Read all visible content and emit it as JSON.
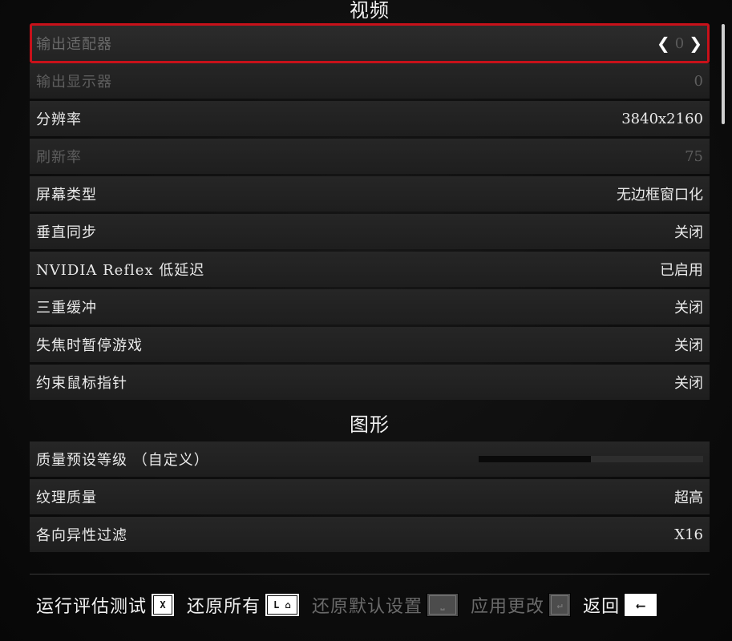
{
  "sections": {
    "video": {
      "title": "视频"
    },
    "graphics": {
      "title": "图形"
    }
  },
  "video_rows": [
    {
      "label": "输出适配器",
      "value": "0",
      "state": "selected"
    },
    {
      "label": "输出显示器",
      "value": "0",
      "state": "disabled"
    },
    {
      "label": "分辨率",
      "value": "3840x2160",
      "state": "normal"
    },
    {
      "label": "刷新率",
      "value": "75",
      "state": "disabled"
    },
    {
      "label": "屏幕类型",
      "value": "无边框窗口化",
      "state": "normal"
    },
    {
      "label": "垂直同步",
      "value": "关闭",
      "state": "normal"
    },
    {
      "label": "NVIDIA  Reflex  低延迟",
      "value": "已启用",
      "state": "normal"
    },
    {
      "label": "三重缓冲",
      "value": "关闭",
      "state": "normal"
    },
    {
      "label": "失焦时暂停游戏",
      "value": "关闭",
      "state": "normal"
    },
    {
      "label": "约束鼠标指针",
      "value": "关闭",
      "state": "normal"
    }
  ],
  "graphics_rows": [
    {
      "label": "质量预设等级 （自定义）",
      "value": "",
      "state": "slider",
      "fill_fraction": 0.5
    },
    {
      "label": "纹理质量",
      "value": "超高",
      "state": "normal"
    },
    {
      "label": "各向异性过滤",
      "value": "X16",
      "state": "normal"
    }
  ],
  "footer": {
    "actions": [
      {
        "label": "运行评估测试",
        "key": "X",
        "enabled": true
      },
      {
        "label": "还原所有",
        "key": "L",
        "key_icon": "home-icon",
        "enabled": true
      },
      {
        "label": "还原默认设置",
        "key_icon": "space-key-icon",
        "enabled": false
      },
      {
        "label": "应用更改",
        "key_icon": "enter-key-icon",
        "enabled": false
      },
      {
        "label": "返回",
        "key_icon": "backspace-arrow-icon",
        "enabled": true
      }
    ]
  },
  "colors": {
    "selection_border": "#c8111a",
    "row_bg": "#232323",
    "disabled_text": "#5e5e5e"
  }
}
